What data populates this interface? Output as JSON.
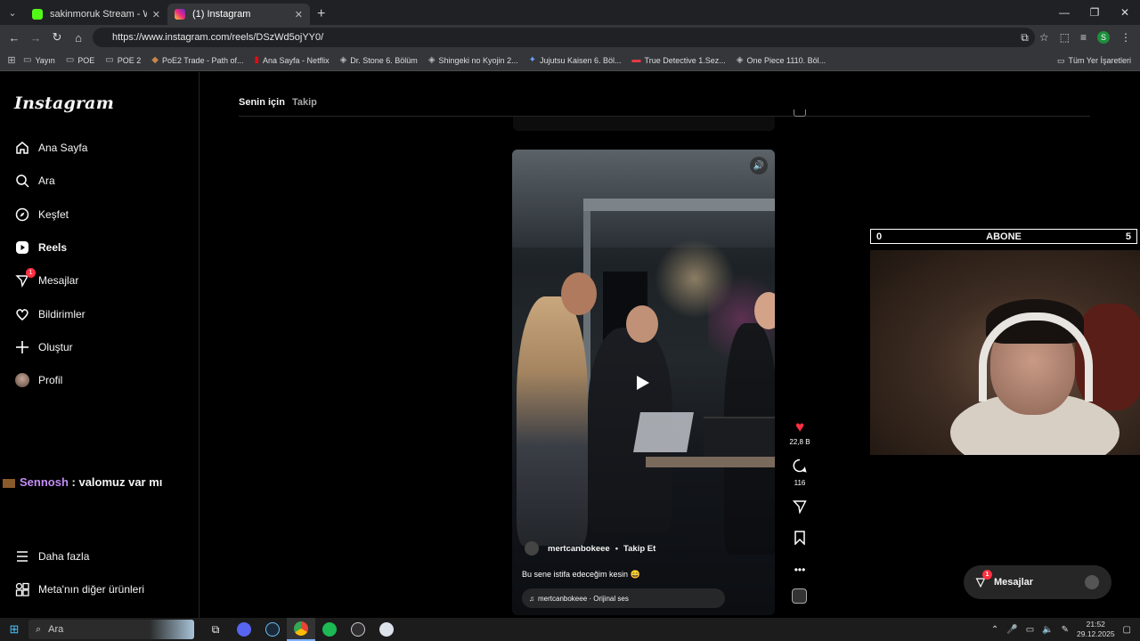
{
  "browser": {
    "tabs": [
      {
        "title": "sakinmoruk Stream - Watch Live",
        "active": false,
        "color": "#53fc18"
      },
      {
        "title": "(1) Instagram",
        "active": true,
        "color": "#e1306c"
      }
    ],
    "url": "https://www.instagram.com/reels/DSzWd5ojYY0/",
    "profile_initial": "S",
    "bookmarks": [
      "Yayın",
      "POE",
      "POE 2",
      "PoE2 Trade - Path of...",
      "Ana Sayfa - Netflix",
      "Dr. Stone 6. Bölüm",
      "Shingeki no Kyojin 2...",
      "Jujutsu Kaisen 6. Böl...",
      "True Detective 1.Sez...",
      "One Piece 1110. Böl..."
    ],
    "bookmarks_right": "Tüm Yer İşaretleri"
  },
  "sidebar": {
    "logo": "Instagram",
    "items": [
      {
        "label": "Ana Sayfa",
        "icon": "home-icon"
      },
      {
        "label": "Ara",
        "icon": "search-icon"
      },
      {
        "label": "Keşfet",
        "icon": "compass-icon"
      },
      {
        "label": "Reels",
        "icon": "reels-icon"
      },
      {
        "label": "Mesajlar",
        "icon": "messenger-icon",
        "badge": "1"
      },
      {
        "label": "Bildirimler",
        "icon": "heart-icon"
      },
      {
        "label": "Oluştur",
        "icon": "plus-icon"
      },
      {
        "label": "Profil",
        "icon": "avatar"
      }
    ],
    "more": "Daha fazla",
    "meta": "Meta'nın diğer ürünleri"
  },
  "chat_overlay": {
    "user": "Sennosh",
    "message": " : valomuz var mı"
  },
  "feed_tabs": {
    "for_you": "Senin için",
    "following": "Takip"
  },
  "reel": {
    "username": "mertcanbokeee",
    "follow": "Takip Et",
    "caption": "Bu sene istifa edeceğim kesin 😄",
    "audio": "mertcanbokeee · Orijinal ses",
    "likes": "22,8 B",
    "comments": "116"
  },
  "stream_overlay": {
    "left": "0",
    "label": "ABONE",
    "right": "5"
  },
  "messages_pill": {
    "label": "Mesajlar",
    "badge": "1"
  },
  "taskbar": {
    "search": "Ara",
    "time": "21:52",
    "date": "29.12.2025"
  }
}
